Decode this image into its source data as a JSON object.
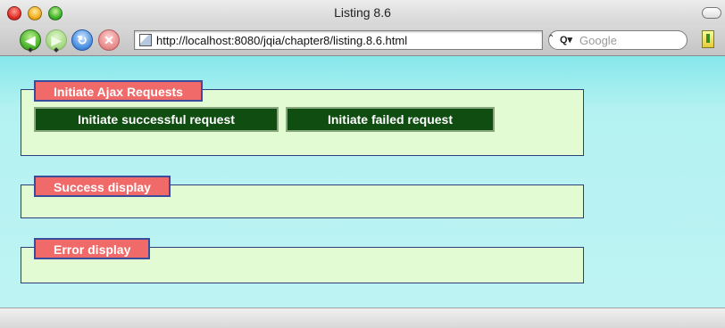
{
  "window": {
    "title": "Listing 8.6"
  },
  "toolbar": {
    "url": "http://localhost:8080/jqia/chapter8/listing.8.6.html",
    "search_placeholder": "Google"
  },
  "sections": {
    "initiate": {
      "legend": "Initiate Ajax Requests",
      "success_button": "Initiate successful request",
      "failed_button": "Initiate failed request"
    },
    "success": {
      "legend": "Success display"
    },
    "error": {
      "legend": "Error display"
    }
  },
  "colors": {
    "page_background": "#b4f2f2",
    "fieldset_background": "#e3fbd2",
    "legend_background": "#f06a6a",
    "button_background": "#0f4d10"
  }
}
